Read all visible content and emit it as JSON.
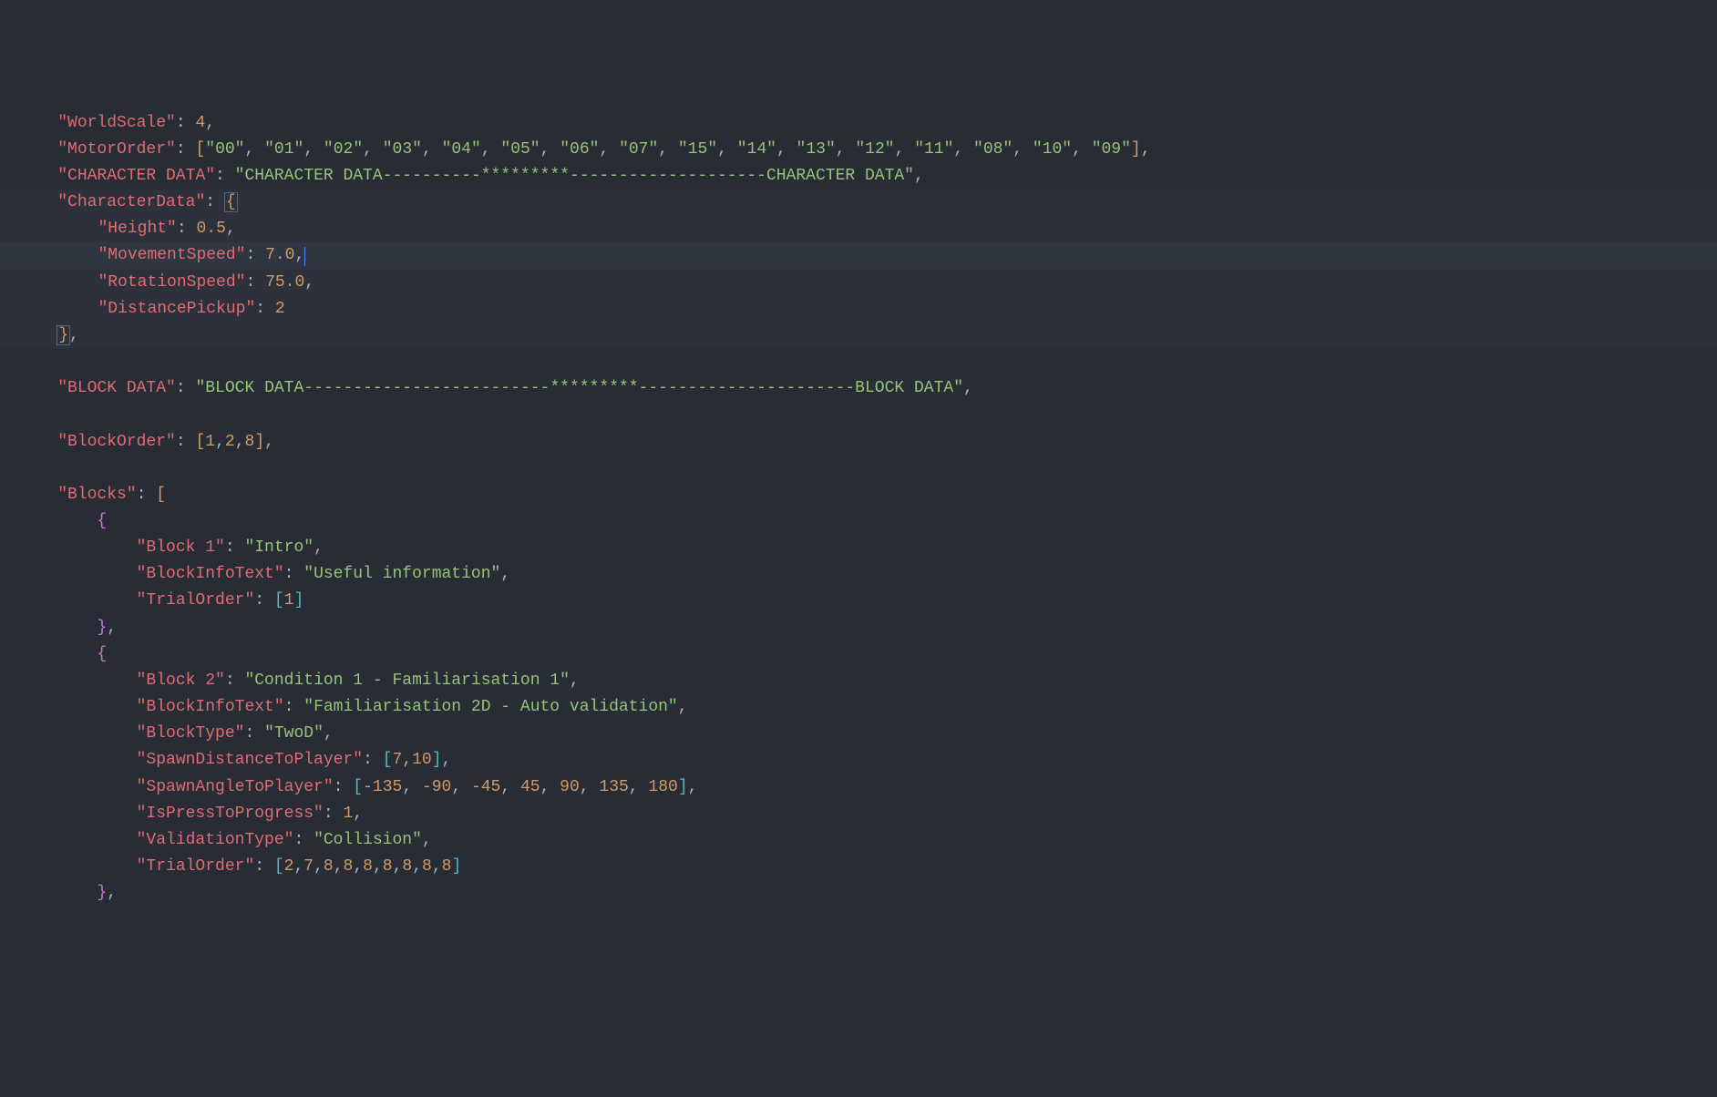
{
  "lines": [
    {
      "indent": 1,
      "highlighted": false,
      "tokens": [
        {
          "t": "key",
          "v": "\"WorldScale\""
        },
        {
          "t": "punct",
          "v": ": "
        },
        {
          "t": "number",
          "v": "4"
        },
        {
          "t": "punct",
          "v": ","
        }
      ]
    },
    {
      "indent": 1,
      "highlighted": false,
      "tokens": [
        {
          "t": "key",
          "v": "\"MotorOrder\""
        },
        {
          "t": "punct",
          "v": ": "
        },
        {
          "t": "bracket1",
          "v": "["
        },
        {
          "t": "string",
          "v": "\"00\""
        },
        {
          "t": "punct",
          "v": ", "
        },
        {
          "t": "string",
          "v": "\"01\""
        },
        {
          "t": "punct",
          "v": ", "
        },
        {
          "t": "string",
          "v": "\"02\""
        },
        {
          "t": "punct",
          "v": ", "
        },
        {
          "t": "string",
          "v": "\"03\""
        },
        {
          "t": "punct",
          "v": ", "
        },
        {
          "t": "string",
          "v": "\"04\""
        },
        {
          "t": "punct",
          "v": ", "
        },
        {
          "t": "string",
          "v": "\"05\""
        },
        {
          "t": "punct",
          "v": ", "
        },
        {
          "t": "string",
          "v": "\"06\""
        },
        {
          "t": "punct",
          "v": ", "
        },
        {
          "t": "string",
          "v": "\"07\""
        },
        {
          "t": "punct",
          "v": ", "
        },
        {
          "t": "string",
          "v": "\"15\""
        },
        {
          "t": "punct",
          "v": ", "
        },
        {
          "t": "string",
          "v": "\"14\""
        },
        {
          "t": "punct",
          "v": ", "
        },
        {
          "t": "string",
          "v": "\"13\""
        },
        {
          "t": "punct",
          "v": ", "
        },
        {
          "t": "string",
          "v": "\"12\""
        },
        {
          "t": "punct",
          "v": ", "
        },
        {
          "t": "string",
          "v": "\"11\""
        },
        {
          "t": "punct",
          "v": ", "
        },
        {
          "t": "string",
          "v": "\"08\""
        },
        {
          "t": "punct",
          "v": ", "
        },
        {
          "t": "string",
          "v": "\"10\""
        },
        {
          "t": "punct",
          "v": ", "
        },
        {
          "t": "string",
          "v": "\"09\""
        },
        {
          "t": "bracket1",
          "v": "]"
        },
        {
          "t": "punct",
          "v": ","
        }
      ]
    },
    {
      "indent": 1,
      "highlighted": false,
      "tokens": [
        {
          "t": "key",
          "v": "\"CHARACTER DATA\""
        },
        {
          "t": "punct",
          "v": ": "
        },
        {
          "t": "string",
          "v": "\"CHARACTER DATA----------*********--------------------CHARACTER DATA\""
        },
        {
          "t": "punct",
          "v": ","
        }
      ]
    },
    {
      "indent": 1,
      "highlighted": true,
      "tokens": [
        {
          "t": "key",
          "v": "\"CharacterData\""
        },
        {
          "t": "punct",
          "v": ": "
        },
        {
          "t": "bracket1",
          "v": "{",
          "box": true
        }
      ]
    },
    {
      "indent": 2,
      "highlighted": true,
      "guide": true,
      "tokens": [
        {
          "t": "key",
          "v": "\"Height\""
        },
        {
          "t": "punct",
          "v": ": "
        },
        {
          "t": "number",
          "v": "0.5"
        },
        {
          "t": "punct",
          "v": ","
        }
      ]
    },
    {
      "indent": 2,
      "highlighted": true,
      "guide": true,
      "cursor": true,
      "tokens": [
        {
          "t": "key",
          "v": "\"MovementSpeed\""
        },
        {
          "t": "punct",
          "v": ": "
        },
        {
          "t": "number",
          "v": "7.0"
        },
        {
          "t": "punct",
          "v": ","
        }
      ]
    },
    {
      "indent": 2,
      "highlighted": true,
      "guide": true,
      "tokens": [
        {
          "t": "key",
          "v": "\"RotationSpeed\""
        },
        {
          "t": "punct",
          "v": ": "
        },
        {
          "t": "number",
          "v": "75.0"
        },
        {
          "t": "punct",
          "v": ","
        }
      ]
    },
    {
      "indent": 2,
      "highlighted": true,
      "guide": true,
      "tokens": [
        {
          "t": "key",
          "v": "\"DistancePickup\""
        },
        {
          "t": "punct",
          "v": ": "
        },
        {
          "t": "number",
          "v": "2"
        }
      ]
    },
    {
      "indent": 1,
      "highlighted": true,
      "tokens": [
        {
          "t": "bracket1",
          "v": "}",
          "box": true
        },
        {
          "t": "punct",
          "v": ","
        }
      ]
    },
    {
      "indent": 1,
      "highlighted": false,
      "blank": true,
      "tokens": []
    },
    {
      "indent": 1,
      "highlighted": false,
      "tokens": [
        {
          "t": "key",
          "v": "\"BLOCK DATA\""
        },
        {
          "t": "punct",
          "v": ": "
        },
        {
          "t": "string",
          "v": "\"BLOCK DATA-------------------------*********----------------------BLOCK DATA\""
        },
        {
          "t": "punct",
          "v": ","
        }
      ]
    },
    {
      "indent": 1,
      "highlighted": false,
      "blank": true,
      "tokens": []
    },
    {
      "indent": 1,
      "highlighted": false,
      "tokens": [
        {
          "t": "key",
          "v": "\"BlockOrder\""
        },
        {
          "t": "punct",
          "v": ": "
        },
        {
          "t": "bracket1",
          "v": "["
        },
        {
          "t": "number",
          "v": "1"
        },
        {
          "t": "punct",
          "v": ","
        },
        {
          "t": "number",
          "v": "2"
        },
        {
          "t": "punct",
          "v": ","
        },
        {
          "t": "number",
          "v": "8"
        },
        {
          "t": "bracket1",
          "v": "]"
        },
        {
          "t": "punct",
          "v": ","
        }
      ]
    },
    {
      "indent": 1,
      "highlighted": false,
      "blank": true,
      "tokens": []
    },
    {
      "indent": 1,
      "highlighted": false,
      "tokens": [
        {
          "t": "key",
          "v": "\"Blocks\""
        },
        {
          "t": "punct",
          "v": ": "
        },
        {
          "t": "bracket1",
          "v": "["
        }
      ]
    },
    {
      "indent": 2,
      "highlighted": false,
      "tokens": [
        {
          "t": "bracket2",
          "v": "{"
        }
      ]
    },
    {
      "indent": 3,
      "highlighted": false,
      "tokens": [
        {
          "t": "key",
          "v": "\"Block 1\""
        },
        {
          "t": "punct",
          "v": ": "
        },
        {
          "t": "string",
          "v": "\"Intro\""
        },
        {
          "t": "punct",
          "v": ","
        }
      ]
    },
    {
      "indent": 3,
      "highlighted": false,
      "tokens": [
        {
          "t": "key",
          "v": "\"BlockInfoText\""
        },
        {
          "t": "punct",
          "v": ": "
        },
        {
          "t": "string",
          "v": "\"Useful information\""
        },
        {
          "t": "punct",
          "v": ","
        }
      ]
    },
    {
      "indent": 3,
      "highlighted": false,
      "tokens": [
        {
          "t": "key",
          "v": "\"TrialOrder\""
        },
        {
          "t": "punct",
          "v": ": "
        },
        {
          "t": "bracket3",
          "v": "["
        },
        {
          "t": "number",
          "v": "1"
        },
        {
          "t": "bracket3",
          "v": "]"
        }
      ]
    },
    {
      "indent": 2,
      "highlighted": false,
      "tokens": [
        {
          "t": "bracket2",
          "v": "}"
        },
        {
          "t": "punct",
          "v": ","
        }
      ]
    },
    {
      "indent": 2,
      "highlighted": false,
      "tokens": [
        {
          "t": "bracket2",
          "v": "{"
        }
      ]
    },
    {
      "indent": 3,
      "highlighted": false,
      "tokens": [
        {
          "t": "key",
          "v": "\"Block 2\""
        },
        {
          "t": "punct",
          "v": ": "
        },
        {
          "t": "string",
          "v": "\"Condition 1 - Familiarisation 1\""
        },
        {
          "t": "punct",
          "v": ","
        }
      ]
    },
    {
      "indent": 3,
      "highlighted": false,
      "tokens": [
        {
          "t": "key",
          "v": "\"BlockInfoText\""
        },
        {
          "t": "punct",
          "v": ": "
        },
        {
          "t": "string",
          "v": "\"Familiarisation 2D - Auto validation\""
        },
        {
          "t": "punct",
          "v": ","
        }
      ]
    },
    {
      "indent": 3,
      "highlighted": false,
      "tokens": [
        {
          "t": "key",
          "v": "\"BlockType\""
        },
        {
          "t": "punct",
          "v": ": "
        },
        {
          "t": "string",
          "v": "\"TwoD\""
        },
        {
          "t": "punct",
          "v": ","
        }
      ]
    },
    {
      "indent": 3,
      "highlighted": false,
      "tokens": [
        {
          "t": "key",
          "v": "\"SpawnDistanceToPlayer\""
        },
        {
          "t": "punct",
          "v": ": "
        },
        {
          "t": "bracket3",
          "v": "["
        },
        {
          "t": "number",
          "v": "7"
        },
        {
          "t": "punct",
          "v": ","
        },
        {
          "t": "number",
          "v": "10"
        },
        {
          "t": "bracket3",
          "v": "]"
        },
        {
          "t": "punct",
          "v": ","
        }
      ]
    },
    {
      "indent": 3,
      "highlighted": false,
      "tokens": [
        {
          "t": "key",
          "v": "\"SpawnAngleToPlayer\""
        },
        {
          "t": "punct",
          "v": ": "
        },
        {
          "t": "bracket3",
          "v": "["
        },
        {
          "t": "number",
          "v": "-135"
        },
        {
          "t": "punct",
          "v": ", "
        },
        {
          "t": "number",
          "v": "-90"
        },
        {
          "t": "punct",
          "v": ", "
        },
        {
          "t": "number",
          "v": "-45"
        },
        {
          "t": "punct",
          "v": ", "
        },
        {
          "t": "number",
          "v": "45"
        },
        {
          "t": "punct",
          "v": ", "
        },
        {
          "t": "number",
          "v": "90"
        },
        {
          "t": "punct",
          "v": ", "
        },
        {
          "t": "number",
          "v": "135"
        },
        {
          "t": "punct",
          "v": ", "
        },
        {
          "t": "number",
          "v": "180"
        },
        {
          "t": "bracket3",
          "v": "]"
        },
        {
          "t": "punct",
          "v": ","
        }
      ]
    },
    {
      "indent": 3,
      "highlighted": false,
      "tokens": [
        {
          "t": "key",
          "v": "\"IsPressToProgress\""
        },
        {
          "t": "punct",
          "v": ": "
        },
        {
          "t": "number",
          "v": "1"
        },
        {
          "t": "punct",
          "v": ","
        }
      ]
    },
    {
      "indent": 3,
      "highlighted": false,
      "tokens": [
        {
          "t": "key",
          "v": "\"ValidationType\""
        },
        {
          "t": "punct",
          "v": ": "
        },
        {
          "t": "string",
          "v": "\"Collision\""
        },
        {
          "t": "punct",
          "v": ","
        }
      ]
    },
    {
      "indent": 3,
      "highlighted": false,
      "tokens": [
        {
          "t": "key",
          "v": "\"TrialOrder\""
        },
        {
          "t": "punct",
          "v": ": "
        },
        {
          "t": "bracket3",
          "v": "["
        },
        {
          "t": "number",
          "v": "2"
        },
        {
          "t": "punct",
          "v": ","
        },
        {
          "t": "number",
          "v": "7"
        },
        {
          "t": "punct",
          "v": ","
        },
        {
          "t": "number",
          "v": "8"
        },
        {
          "t": "punct",
          "v": ","
        },
        {
          "t": "number",
          "v": "8"
        },
        {
          "t": "punct",
          "v": ","
        },
        {
          "t": "number",
          "v": "8"
        },
        {
          "t": "punct",
          "v": ","
        },
        {
          "t": "number",
          "v": "8"
        },
        {
          "t": "punct",
          "v": ","
        },
        {
          "t": "number",
          "v": "8"
        },
        {
          "t": "punct",
          "v": ","
        },
        {
          "t": "number",
          "v": "8"
        },
        {
          "t": "punct",
          "v": ","
        },
        {
          "t": "number",
          "v": "8"
        },
        {
          "t": "bracket3",
          "v": "]"
        }
      ]
    },
    {
      "indent": 2,
      "highlighted": false,
      "tokens": [
        {
          "t": "bracket2",
          "v": "}"
        },
        {
          "t": "punct",
          "v": ","
        }
      ]
    }
  ],
  "indentUnit": "    "
}
